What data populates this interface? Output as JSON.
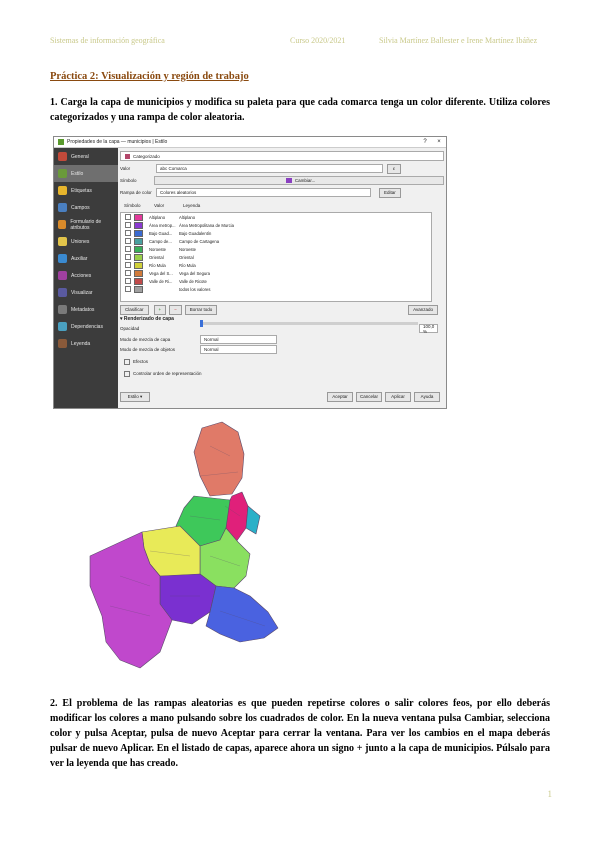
{
  "header": {
    "subject": "Sistemas de información geográfica",
    "course": "Curso 2020/2021",
    "authors": "Silvia Martínez Ballester e Irene Martínez Ibáñez"
  },
  "title": "Práctica 2: Visualización y región de trabajo",
  "para1": "1. Carga la capa de municipios y modifica su paleta para que cada comarca tenga un color diferente. Utiliza colores categorizados y una rampa de color aleatoria.",
  "para2": "2. El problema de las rampas aleatorias es que pueden repetirse colores o salir colores feos, por ello deberás modificar los colores a mano pulsando sobre los cuadrados de color. En la nueva ventana pulsa Cambiar, selecciona color y pulsa Aceptar, pulsa de nuevo Aceptar para cerrar la ventana. Para ver los cambios en el mapa deberás pulsar de nuevo Aplicar. En el listado de capas, aparece ahora un signo + junto a la capa de municipios. Púlsalo para ver la leyenda que has creado.",
  "page_number": "1",
  "dialog": {
    "title": "Propiedades de la capa — municipios | Estilo",
    "close": "×",
    "help": "?",
    "sidebar": [
      {
        "label": "General",
        "color": "#c24a3a"
      },
      {
        "label": "Estilo",
        "color": "#6a9a3a"
      },
      {
        "label": "Etiquetas",
        "color": "#e7b52c"
      },
      {
        "label": "Campos",
        "color": "#4a7fc0"
      },
      {
        "label": "Formulario de atributos",
        "color": "#d88a2a"
      },
      {
        "label": "Uniones",
        "color": "#e2c44a"
      },
      {
        "label": "Auxiliar",
        "color": "#3a8ad0"
      },
      {
        "label": "Acciones",
        "color": "#a040a0"
      },
      {
        "label": "Visualizar",
        "color": "#5a5aa0"
      },
      {
        "label": "Metadatos",
        "color": "#7a7a7a"
      },
      {
        "label": "Dependencias",
        "color": "#4aa0c0"
      },
      {
        "label": "Leyenda",
        "color": "#8a5a3a"
      }
    ],
    "renderer": "Categorizado",
    "value_label": "Valor",
    "value": "abc Comarca",
    "symbol_label": "Símbolo",
    "symbol_value": "Cambiar...",
    "ramp_label": "Rampa de color",
    "ramp_value": "Colores aleatorios",
    "edit_label": "Editar",
    "col_symbol": "Símbolo",
    "col_value": "Valor",
    "col_legend": "Leyenda",
    "categories": [
      {
        "value": "Altiplano",
        "legend": "Altiplano",
        "color": "#e23a9a"
      },
      {
        "value": "Área metrop...",
        "legend": "Área Metropolitana de Murcia",
        "color": "#8a3ad0"
      },
      {
        "value": "Bajo Guad...",
        "legend": "Bajo Guadalentín",
        "color": "#3a6ad0"
      },
      {
        "value": "Campo de...",
        "legend": "Campo de Cartagena",
        "color": "#4aa0a0"
      },
      {
        "value": "Noroeste",
        "legend": "Noroeste",
        "color": "#3ab05a"
      },
      {
        "value": "Oriental",
        "legend": "Oriental",
        "color": "#9ad04a"
      },
      {
        "value": "Río Mula",
        "legend": "Río Mula",
        "color": "#d0d03a"
      },
      {
        "value": "Vega del S...",
        "legend": "Vega del Segura",
        "color": "#d07a3a"
      },
      {
        "value": "Valle de Ri...",
        "legend": "Valle de Ricote",
        "color": "#c04a4a"
      },
      {
        "value": "",
        "legend": "todos los valores",
        "color": "#a0a0a0"
      }
    ],
    "classify_btn": "Clasificar",
    "delete_all_btn": "Borrar todo",
    "advanced_btn": "Avanzado",
    "render_section": "Renderizado de capa",
    "opacity_label": "Opacidad",
    "opacity_value": "100,0 %",
    "blend_layer_label": "Modo de mezcla de capa",
    "blend_layer_value": "Normal",
    "blend_feature_label": "Modo de mezcla de objetos",
    "blend_feature_value": "Normal",
    "effects_label": "Efectos",
    "order_label": "Controlar orden de representación",
    "style_btn": "Estilo",
    "accept_btn": "Aceptar",
    "cancel_btn": "Cancelar",
    "apply_btn": "Aplicar",
    "help_btn": "Ayuda"
  },
  "map_colors": {
    "salmon": "#e07a68",
    "magenta": "#e0207a",
    "green": "#3ec85a",
    "lightgreen": "#8ae060",
    "yellow": "#e8ea58",
    "purple": "#7a30d0",
    "violet": "#c048cc",
    "blue": "#4a62e0",
    "teal": "#2ab0c8"
  }
}
